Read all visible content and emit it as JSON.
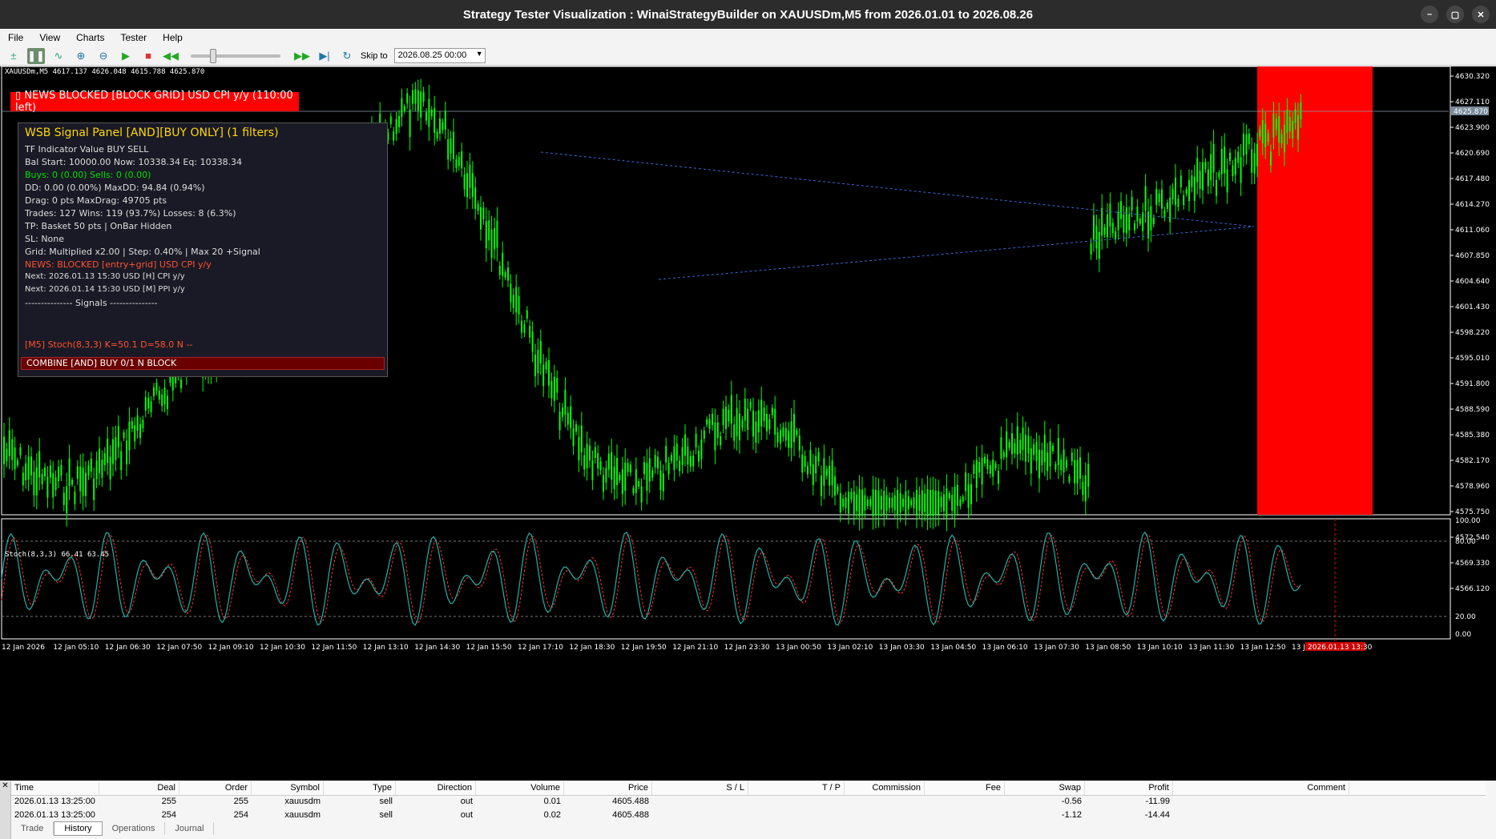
{
  "window": {
    "title": "Strategy Tester Visualization : WinaiStrategyBuilder on XAUUSDm,M5 from 2026.01.01 to 2026.08.26",
    "buttons": [
      "–",
      "▢",
      "✕"
    ]
  },
  "menu": [
    "File",
    "View",
    "Charts",
    "Tester",
    "Help"
  ],
  "toolbar": {
    "skip_label": "Skip to",
    "skip_date": "2026.08.25 00:00"
  },
  "chart": {
    "symbol_info": "XAUUSDm,M5  4617.137 4626.048 4615.788 4625.870",
    "news_banner": "▯ NEWS BLOCKED [BLOCK GRID] USD CPI y/y  (110:00 left)",
    "current_price": "4625.870",
    "price_axis": [
      "4630.320",
      "4627.110",
      "4623.900",
      "4620.690",
      "4617.480",
      "4614.270",
      "4611.060",
      "4607.850",
      "4604.640",
      "4601.430",
      "4598.220",
      "4595.010",
      "4591.800",
      "4588.590",
      "4585.380",
      "4582.170",
      "4578.960",
      "4575.750",
      "4572.540",
      "4569.330",
      "4566.120"
    ],
    "time_axis": [
      "12 Jan 2026",
      "12 Jan 05:10",
      "12 Jan 06:30",
      "12 Jan 07:50",
      "12 Jan 09:10",
      "12 Jan 10:30",
      "12 Jan 11:50",
      "12 Jan 13:10",
      "12 Jan 14:30",
      "12 Jan 15:50",
      "12 Jan 17:10",
      "12 Jan 18:30",
      "12 Jan 19:50",
      "12 Jan 21:10",
      "12 Jan 23:30",
      "13 Jan 00:50",
      "13 Jan 02:10",
      "13 Jan 03:30",
      "13 Jan 04:50",
      "13 Jan 06:10",
      "13 Jan 07:30",
      "13 Jan 08:50",
      "13 Jan 10:10",
      "13 Jan 11:30",
      "13 Jan 12:50",
      "13 Jan"
    ],
    "time_marker": "2026.01.13 13:30",
    "colors": {
      "bull": "#00ff00",
      "bear": "#00ff00",
      "news_zone": "#ff0000",
      "stoch_main": "#20b2aa",
      "stoch_signal": "#ff3030"
    }
  },
  "panel": {
    "title": "WSB Signal Panel  [AND][BUY ONLY]  (1 filters)",
    "header": "TF  Indicator          Value              BUY   SELL",
    "balance": "Bal Start: 10000.00  Now: 10338.34  Eq: 10338.34",
    "buys": "Buys: 0 (0.00)  Sells: 0 (0.00)",
    "dd": "DD: 0.00 (0.00%)  MaxDD: 94.84 (0.94%)",
    "drag": "Drag: 0 pts  MaxDrag: 49705 pts",
    "trades": "Trades: 127  Wins: 119 (93.7%)  Losses: 8 (6.3%)",
    "tp": "TP: Basket 50 pts | OnBar Hidden",
    "sl": "SL: None",
    "grid": "Grid: Multiplied x2.00 | Step: 0.40% | Max 20 +Signal",
    "news": "NEWS: BLOCKED [entry+grid] USD CPI y/y",
    "next1": "Next: 2026.01.13 15:30 USD [H] CPI y/y",
    "next2": "Next: 2026.01.14 15:30 USD [M] PPI y/y",
    "signals": "--------------- Signals ---------------",
    "stoch_row": "[M5] Stoch(8,3,3)  K=50.1 D=58.0   N    --",
    "combine": "COMBINE [AND]  BUY 0/1 N BLOCK"
  },
  "stochastic": {
    "label": "Stoch(8,3,3) 66.41 63.45",
    "levels": [
      "100.00",
      "80.00",
      "20.00",
      "0.00"
    ]
  },
  "history": {
    "columns": [
      "Time",
      "Deal",
      "Order",
      "Symbol",
      "Type",
      "Direction",
      "Volume",
      "Price",
      "S / L",
      "T / P",
      "Commission",
      "Fee",
      "Swap",
      "Profit",
      "Comment"
    ],
    "rows": [
      [
        "2026.01.13 13:25:00",
        "255",
        "255",
        "xauusdm",
        "sell",
        "out",
        "0.01",
        "4605.488",
        "",
        "",
        "",
        "",
        "-0.56",
        "-11.99",
        ""
      ],
      [
        "2026.01.13 13:25:00",
        "254",
        "254",
        "xauusdm",
        "sell",
        "out",
        "0.02",
        "4605.488",
        "",
        "",
        "",
        "",
        "-1.12",
        "-14.44",
        ""
      ]
    ],
    "tabs": [
      "Trade",
      "History",
      "Operations",
      "Journal"
    ]
  }
}
